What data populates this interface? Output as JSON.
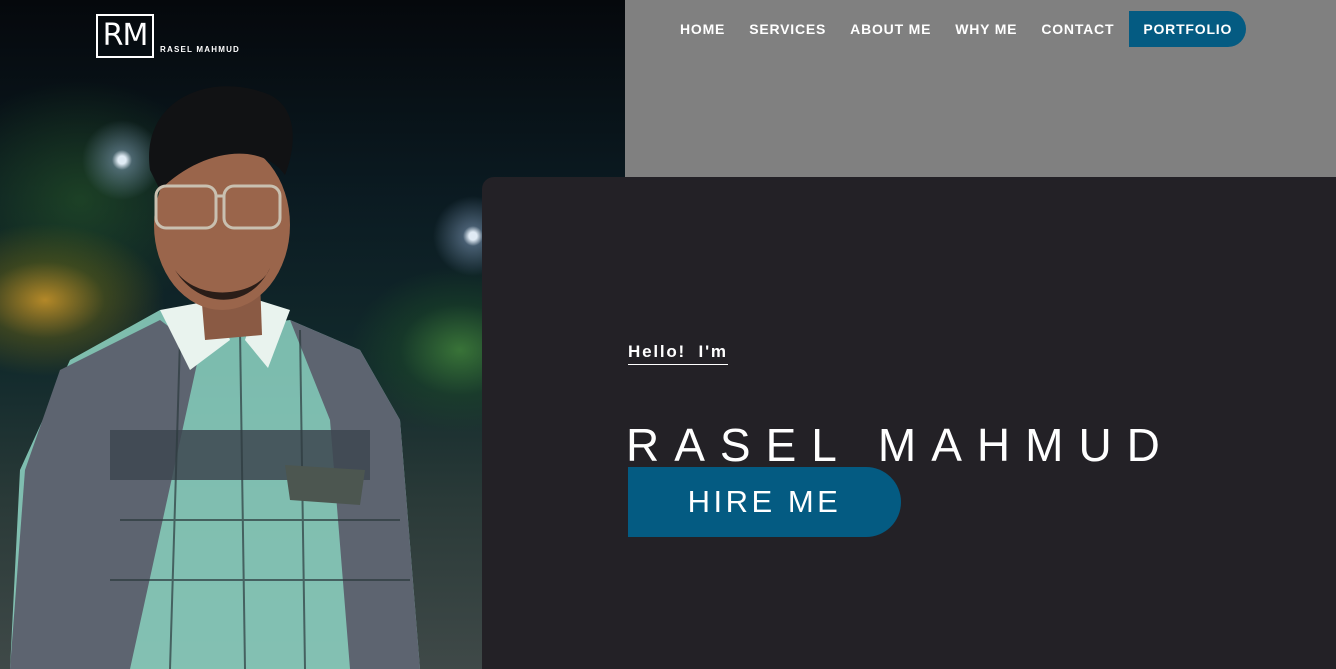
{
  "brand": {
    "monogram": "RM",
    "name": "RASEL MAHMUD"
  },
  "nav": {
    "items": [
      {
        "label": "HOME"
      },
      {
        "label": "SERVICES"
      },
      {
        "label": "ABOUT ME"
      },
      {
        "label": "WHY ME"
      },
      {
        "label": "CONTACT"
      },
      {
        "label": "PORTFOLIO",
        "active": true
      }
    ]
  },
  "hero": {
    "greeting": "Hello! I'm",
    "name": "RASEL MAHMUD",
    "cta_label": "HIRE ME"
  },
  "colors": {
    "accent": "#045b82",
    "card_bg": "#232126",
    "page_bg": "#808080",
    "text": "#ffffff"
  }
}
